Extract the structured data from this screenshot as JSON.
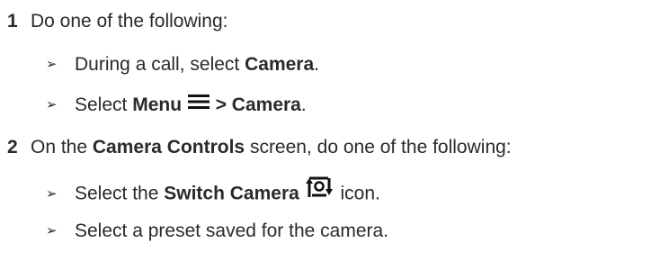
{
  "steps": [
    {
      "number": "1",
      "text": "Do one of the following:",
      "substeps": [
        {
          "bullet": "➢",
          "before": "During a call, select ",
          "bold": "Camera",
          "after": "."
        },
        {
          "bullet": "➢",
          "before": "Select ",
          "bold1": "Menu",
          "icon": "menu-hamburger-icon",
          "bold2": " > Camera",
          "after": "."
        }
      ]
    },
    {
      "number": "2",
      "before": "On the ",
      "bold": "Camera Controls",
      "after": " screen, do one of the following:",
      "substeps": [
        {
          "bullet": "➢",
          "before": "Select the ",
          "bold": "Switch Camera",
          "icon": "switch-camera-icon",
          "after": " icon."
        },
        {
          "bullet": "➢",
          "text": "Select a preset saved for the camera."
        }
      ]
    }
  ]
}
